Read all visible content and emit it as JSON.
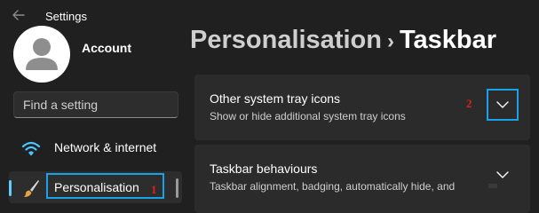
{
  "window": {
    "title": "Settings"
  },
  "account": {
    "name": "Account"
  },
  "search": {
    "placeholder": "Find a setting"
  },
  "sidebar": {
    "items": [
      {
        "label": "Network & internet",
        "icon": "wifi-icon"
      },
      {
        "label": "Personalisation",
        "icon": "brush-icon",
        "selected": true
      }
    ]
  },
  "breadcrumb": {
    "parent": "Personalisation",
    "separator": "›",
    "current": "Taskbar"
  },
  "cards": [
    {
      "title": "Other system tray icons",
      "subtitle": "Show or hide additional system tray icons",
      "expanded": false
    },
    {
      "title": "Taskbar behaviours",
      "subtitle": "Taskbar alignment, badging, automatically hide, and",
      "expanded": false
    }
  ],
  "annotations": {
    "step1": "1",
    "step2": "2"
  },
  "colors": {
    "accent": "#60cdff",
    "highlight_box": "#1aa2e8",
    "annotation_red": "#e0201c",
    "background": "#202020",
    "card": "#2b2b2b"
  }
}
